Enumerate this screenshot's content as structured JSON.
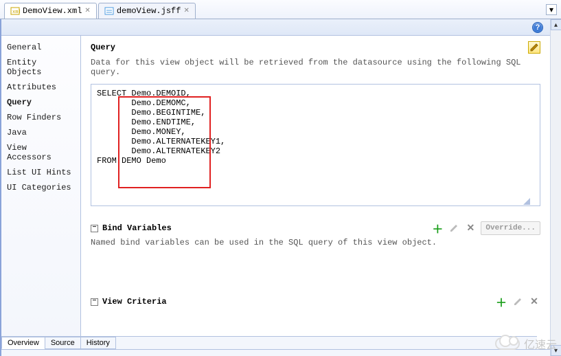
{
  "tabs": [
    {
      "label": "DemoView.xml",
      "active": true
    },
    {
      "label": "demoView.jsff",
      "active": false
    }
  ],
  "sidebar": {
    "items": [
      "General",
      "Entity Objects",
      "Attributes",
      "Query",
      "Row Finders",
      "Java",
      "View Accessors",
      "List UI Hints",
      "UI Categories"
    ],
    "selected_index": 3
  },
  "query": {
    "title": "Query",
    "desc": "Data for this view object will be retrieved from the datasource using the following SQL query.",
    "sql_select": "SELECT",
    "sql_cols": [
      "Demo.DEMOID,",
      "Demo.DEMOMC,",
      "Demo.BEGINTIME,",
      "Demo.ENDTIME,",
      "Demo.MONEY,",
      "Demo.ALTERNATEKEY1,",
      "Demo.ALTERNATEKEY2"
    ],
    "sql_from": "FROM DEMO Demo"
  },
  "bind": {
    "title": "Bind Variables",
    "desc": "Named bind variables can be used in the SQL query of this view object.",
    "override_label": "Override..."
  },
  "view_criteria": {
    "title": "View Criteria"
  },
  "bottom_tabs": [
    "Overview",
    "Source",
    "History"
  ],
  "bottom_active_index": 0,
  "watermark": "亿速云"
}
